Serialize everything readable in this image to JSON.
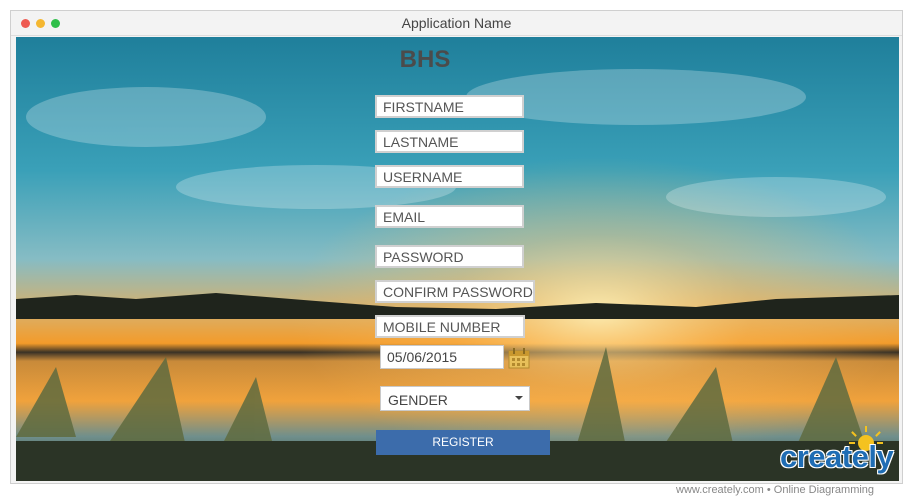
{
  "window": {
    "title": "Application Name"
  },
  "form": {
    "brand": "BHS",
    "firstname_placeholder": "FIRSTNAME",
    "lastname_placeholder": "LASTNAME",
    "username_placeholder": "USERNAME",
    "email_placeholder": "EMAIL",
    "password_placeholder": "PASSWORD",
    "confirm_password_placeholder": "CONFIRM PASSWORD",
    "mobile_placeholder": "MOBILE NUMBER",
    "date_value": "05/06/2015",
    "gender_selected": "GENDER",
    "register_label": "REGISTER"
  },
  "icons": {
    "calendar": "calendar-icon",
    "dropdown": "chevron-down-icon"
  },
  "colors": {
    "register_button": "#3c6cab",
    "logo_blue": "#1f6db4"
  },
  "watermark": {
    "logo_text": "creately",
    "footer": "www.creately.com • Online Diagramming"
  }
}
